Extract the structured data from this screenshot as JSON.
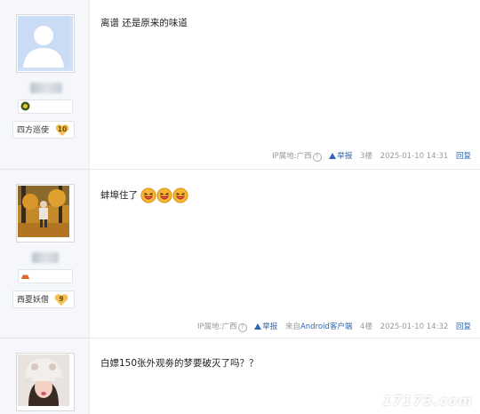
{
  "posts": [
    {
      "content": "离谱 还是原来的味道",
      "badge_title": "四方巡使",
      "badge_level": "10",
      "meta": {
        "ip": "IP属地:广西",
        "report": "举报",
        "source": "",
        "floor": "3楼",
        "time": "2025-01-10 14:31",
        "reply": "回复"
      }
    },
    {
      "content": "蚌埠住了",
      "badge_title": "西夏妖僧",
      "badge_level": "9",
      "meta": {
        "ip": "IP属地:广西",
        "report": "举报",
        "source_prefix": "来自",
        "source_link": "Android客户端",
        "floor": "4楼",
        "time": "2025-01-10 14:32",
        "reply": "回复"
      }
    },
    {
      "content": "白嫖150张外观劵的梦要破灭了吗？？"
    }
  ],
  "watermark": "17173.com",
  "colors": {
    "link": "#2d64b3",
    "sidebar_bg": "#f5f7fa",
    "meta": "#999999"
  },
  "icons": [
    "default-avatar-icon",
    "question-icon",
    "warning-icon",
    "laughing-emoji-icon",
    "level-heart-icon"
  ]
}
